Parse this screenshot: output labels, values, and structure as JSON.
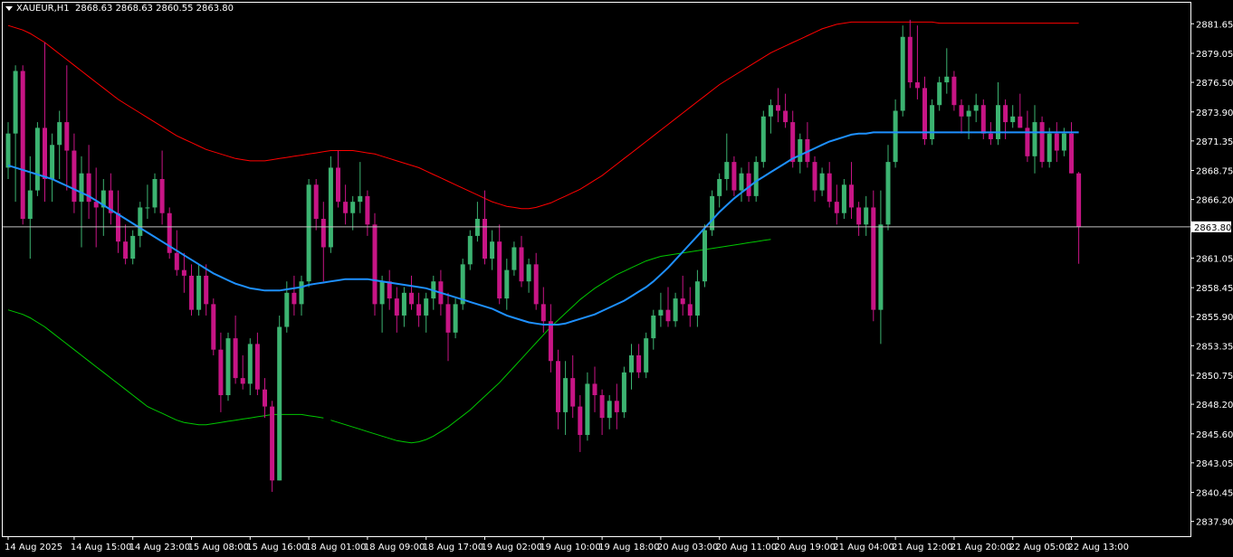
{
  "header": {
    "symbol": "XAUEUR,H1",
    "ohlc": "2868.63 2868.63 2860.55 2863.80"
  },
  "colors": {
    "background": "#000000",
    "frame": "#ffffff",
    "bull": "#3cb371",
    "bear": "#c71585",
    "ma": "#1e90ff",
    "upper_band": "#ff0000",
    "lower_band": "#00c800",
    "price_line": "#c0c0c0"
  },
  "chart_data": {
    "type": "candlestick",
    "symbol": "XAUEUR",
    "timeframe": "H1",
    "ylim": [
      2836.6,
      2883.5
    ],
    "y_ticks": [
      "2881.65",
      "2879.05",
      "2876.50",
      "2873.90",
      "2871.35",
      "2868.75",
      "2866.20",
      "2863.80",
      "2861.05",
      "2858.45",
      "2855.90",
      "2853.35",
      "2850.75",
      "2848.20",
      "2845.60",
      "2843.05",
      "2840.45",
      "2837.90"
    ],
    "x_labels": [
      "14 Aug 2025",
      "14 Aug 15:00",
      "14 Aug 23:00",
      "15 Aug 08:00",
      "15 Aug 16:00",
      "18 Aug 01:00",
      "18 Aug 09:00",
      "18 Aug 17:00",
      "19 Aug 02:00",
      "19 Aug 10:00",
      "19 Aug 18:00",
      "20 Aug 03:00",
      "20 Aug 11:00",
      "20 Aug 19:00",
      "21 Aug 04:00",
      "21 Aug 12:00",
      "21 Aug 20:00",
      "22 Aug 05:00",
      "22 Aug 13:00"
    ],
    "x_label_index": [
      0,
      9,
      17,
      25,
      33,
      41,
      49,
      57,
      65,
      73,
      81,
      89,
      97,
      105,
      113,
      121,
      129,
      137,
      145
    ],
    "current_price": 2863.8,
    "current_price_label": "2863.80",
    "candles": [
      [
        2869.0,
        2873.0,
        2868.0,
        2872.0
      ],
      [
        2872.0,
        2878.0,
        2866.0,
        2877.5
      ],
      [
        2877.5,
        2878.0,
        2864.0,
        2864.5
      ],
      [
        2864.5,
        2870.0,
        2861.0,
        2867.0
      ],
      [
        2867.0,
        2873.0,
        2866.5,
        2872.5
      ],
      [
        2872.5,
        2880.0,
        2866.0,
        2868.0
      ],
      [
        2868.0,
        2872.0,
        2866.0,
        2871.0
      ],
      [
        2871.0,
        2874.0,
        2868.0,
        2873.0
      ],
      [
        2873.0,
        2878.0,
        2867.0,
        2870.5
      ],
      [
        2870.5,
        2872.0,
        2865.0,
        2866.0
      ],
      [
        2866.0,
        2870.0,
        2862.0,
        2868.5
      ],
      [
        2868.5,
        2871.0,
        2864.5,
        2866.0
      ],
      [
        2866.0,
        2869.0,
        2862.0,
        2865.5
      ],
      [
        2865.5,
        2868.0,
        2863.0,
        2867.0
      ],
      [
        2867.0,
        2868.5,
        2864.0,
        2865.0
      ],
      [
        2865.0,
        2867.0,
        2861.5,
        2862.5
      ],
      [
        2862.5,
        2864.0,
        2860.5,
        2861.0
      ],
      [
        2861.0,
        2863.5,
        2860.5,
        2863.0
      ],
      [
        2863.0,
        2866.0,
        2862.0,
        2865.5
      ],
      [
        2865.5,
        2867.5,
        2864.5,
        2865.5
      ],
      [
        2865.5,
        2868.5,
        2865.0,
        2868.0
      ],
      [
        2868.0,
        2870.5,
        2864.0,
        2865.0
      ],
      [
        2865.0,
        2865.5,
        2861.0,
        2861.5
      ],
      [
        2861.5,
        2863.5,
        2859.5,
        2860.0
      ],
      [
        2860.0,
        2861.5,
        2858.0,
        2859.5
      ],
      [
        2859.5,
        2860.5,
        2856.0,
        2856.5
      ],
      [
        2856.5,
        2860.5,
        2856.0,
        2859.5
      ],
      [
        2859.5,
        2860.5,
        2856.0,
        2857.0
      ],
      [
        2857.0,
        2857.5,
        2852.5,
        2853.0
      ],
      [
        2853.0,
        2854.5,
        2847.5,
        2849.0
      ],
      [
        2849.0,
        2854.5,
        2848.5,
        2854.0
      ],
      [
        2854.0,
        2856.0,
        2850.0,
        2850.5
      ],
      [
        2850.5,
        2852.5,
        2849.5,
        2850.0
      ],
      [
        2850.0,
        2854.0,
        2849.0,
        2853.5
      ],
      [
        2853.5,
        2854.5,
        2849.0,
        2849.5
      ],
      [
        2849.5,
        2850.5,
        2847.0,
        2848.0
      ],
      [
        2848.0,
        2848.5,
        2840.5,
        2841.5
      ],
      [
        2841.5,
        2856.0,
        2841.5,
        2855.0
      ],
      [
        2855.0,
        2859.0,
        2854.5,
        2858.0
      ],
      [
        2858.0,
        2859.5,
        2856.0,
        2857.0
      ],
      [
        2857.0,
        2859.5,
        2856.0,
        2859.0
      ],
      [
        2859.0,
        2868.0,
        2858.5,
        2867.5
      ],
      [
        2867.5,
        2868.0,
        2863.5,
        2864.5
      ],
      [
        2864.5,
        2866.0,
        2859.0,
        2862.0
      ],
      [
        2862.0,
        2870.0,
        2861.5,
        2869.0
      ],
      [
        2869.0,
        2870.5,
        2865.5,
        2866.0
      ],
      [
        2866.0,
        2867.5,
        2864.0,
        2865.0
      ],
      [
        2865.0,
        2866.5,
        2863.5,
        2866.0
      ],
      [
        2866.0,
        2869.5,
        2865.0,
        2866.5
      ],
      [
        2866.5,
        2867.0,
        2863.0,
        2864.0
      ],
      [
        2864.0,
        2865.0,
        2856.0,
        2857.0
      ],
      [
        2857.0,
        2859.5,
        2854.5,
        2859.0
      ],
      [
        2859.0,
        2860.0,
        2856.5,
        2857.5
      ],
      [
        2857.5,
        2858.5,
        2854.5,
        2856.0
      ],
      [
        2856.0,
        2858.5,
        2855.0,
        2858.0
      ],
      [
        2858.0,
        2859.5,
        2856.5,
        2857.0
      ],
      [
        2857.0,
        2858.0,
        2855.0,
        2856.0
      ],
      [
        2856.0,
        2858.0,
        2854.5,
        2857.5
      ],
      [
        2857.5,
        2859.5,
        2856.5,
        2859.0
      ],
      [
        2859.0,
        2860.0,
        2856.0,
        2857.0
      ],
      [
        2857.0,
        2858.0,
        2852.0,
        2854.5
      ],
      [
        2854.5,
        2857.5,
        2854.0,
        2857.0
      ],
      [
        2857.0,
        2861.0,
        2856.5,
        2860.5
      ],
      [
        2860.5,
        2863.5,
        2860.0,
        2863.0
      ],
      [
        2863.0,
        2866.0,
        2862.5,
        2864.5
      ],
      [
        2864.5,
        2867.0,
        2860.5,
        2861.0
      ],
      [
        2861.0,
        2863.5,
        2860.0,
        2862.5
      ],
      [
        2862.5,
        2864.0,
        2857.0,
        2857.5
      ],
      [
        2857.5,
        2861.0,
        2856.5,
        2860.0
      ],
      [
        2860.0,
        2862.5,
        2859.5,
        2862.0
      ],
      [
        2862.0,
        2863.0,
        2858.5,
        2859.0
      ],
      [
        2859.0,
        2861.0,
        2858.0,
        2860.5
      ],
      [
        2860.5,
        2861.5,
        2856.5,
        2857.0
      ],
      [
        2857.0,
        2858.5,
        2854.5,
        2855.5
      ],
      [
        2855.5,
        2857.0,
        2851.0,
        2852.0
      ],
      [
        2852.0,
        2853.0,
        2846.0,
        2847.5
      ],
      [
        2847.5,
        2852.0,
        2845.5,
        2850.5
      ],
      [
        2850.5,
        2852.5,
        2847.0,
        2848.0
      ],
      [
        2848.0,
        2849.0,
        2844.0,
        2845.5
      ],
      [
        2845.5,
        2851.0,
        2845.0,
        2850.0
      ],
      [
        2850.0,
        2851.5,
        2847.5,
        2849.0
      ],
      [
        2849.0,
        2849.5,
        2845.5,
        2847.0
      ],
      [
        2847.0,
        2849.0,
        2846.0,
        2848.5
      ],
      [
        2848.5,
        2850.0,
        2846.0,
        2847.5
      ],
      [
        2847.5,
        2851.5,
        2847.0,
        2851.0
      ],
      [
        2851.0,
        2853.5,
        2849.5,
        2852.5
      ],
      [
        2852.5,
        2853.5,
        2850.5,
        2851.0
      ],
      [
        2851.0,
        2854.5,
        2850.5,
        2854.0
      ],
      [
        2854.0,
        2856.5,
        2853.0,
        2856.0
      ],
      [
        2856.0,
        2858.0,
        2855.0,
        2856.5
      ],
      [
        2856.5,
        2858.5,
        2855.0,
        2855.5
      ],
      [
        2855.5,
        2858.0,
        2855.0,
        2857.5
      ],
      [
        2857.5,
        2859.5,
        2856.0,
        2857.0
      ],
      [
        2857.0,
        2858.5,
        2855.0,
        2856.0
      ],
      [
        2856.0,
        2860.0,
        2855.0,
        2859.0
      ],
      [
        2859.0,
        2864.0,
        2858.5,
        2863.5
      ],
      [
        2863.5,
        2867.0,
        2863.0,
        2866.5
      ],
      [
        2866.5,
        2868.5,
        2865.5,
        2868.0
      ],
      [
        2868.0,
        2872.0,
        2867.0,
        2869.5
      ],
      [
        2869.5,
        2870.0,
        2866.5,
        2867.0
      ],
      [
        2867.0,
        2869.0,
        2866.0,
        2868.5
      ],
      [
        2868.5,
        2869.5,
        2866.0,
        2866.5
      ],
      [
        2866.5,
        2870.0,
        2866.0,
        2869.5
      ],
      [
        2869.5,
        2874.0,
        2869.0,
        2873.5
      ],
      [
        2873.5,
        2875.0,
        2872.0,
        2874.5
      ],
      [
        2874.5,
        2876.0,
        2873.0,
        2874.0
      ],
      [
        2874.0,
        2875.5,
        2872.5,
        2873.0
      ],
      [
        2873.0,
        2874.0,
        2869.0,
        2869.5
      ],
      [
        2869.5,
        2872.0,
        2868.5,
        2871.5
      ],
      [
        2871.5,
        2873.0,
        2869.0,
        2869.5
      ],
      [
        2869.5,
        2870.0,
        2866.0,
        2867.0
      ],
      [
        2867.0,
        2869.0,
        2866.5,
        2868.5
      ],
      [
        2868.5,
        2869.5,
        2865.5,
        2866.0
      ],
      [
        2866.0,
        2867.5,
        2864.0,
        2865.0
      ],
      [
        2865.0,
        2868.0,
        2864.5,
        2867.5
      ],
      [
        2867.5,
        2869.5,
        2864.5,
        2865.5
      ],
      [
        2865.5,
        2866.0,
        2863.0,
        2864.0
      ],
      [
        2864.0,
        2866.5,
        2863.0,
        2865.5
      ],
      [
        2865.5,
        2867.0,
        2855.5,
        2856.5
      ],
      [
        2856.5,
        2867.0,
        2853.5,
        2864.0
      ],
      [
        2864.0,
        2871.0,
        2863.5,
        2869.5
      ],
      [
        2869.5,
        2875.0,
        2869.0,
        2874.0
      ],
      [
        2874.0,
        2881.5,
        2873.5,
        2880.5
      ],
      [
        2880.5,
        2882.0,
        2876.0,
        2876.5
      ],
      [
        2876.5,
        2881.5,
        2875.0,
        2876.0
      ],
      [
        2876.0,
        2877.0,
        2871.0,
        2871.5
      ],
      [
        2871.5,
        2875.0,
        2871.0,
        2874.5
      ],
      [
        2874.5,
        2877.0,
        2874.0,
        2876.5
      ],
      [
        2876.5,
        2879.5,
        2875.5,
        2877.0
      ],
      [
        2877.0,
        2877.5,
        2874.0,
        2874.5
      ],
      [
        2874.5,
        2875.0,
        2872.0,
        2873.5
      ],
      [
        2873.5,
        2874.5,
        2871.5,
        2874.0
      ],
      [
        2874.0,
        2875.5,
        2873.0,
        2874.5
      ],
      [
        2874.5,
        2875.0,
        2871.5,
        2872.0
      ],
      [
        2872.0,
        2873.0,
        2871.0,
        2871.5
      ],
      [
        2871.5,
        2876.5,
        2871.0,
        2874.5
      ],
      [
        2874.5,
        2875.0,
        2871.5,
        2873.0
      ],
      [
        2873.0,
        2874.5,
        2872.5,
        2873.5
      ],
      [
        2873.5,
        2875.5,
        2872.5,
        2872.5
      ],
      [
        2872.5,
        2874.0,
        2869.5,
        2870.0
      ],
      [
        2870.0,
        2874.5,
        2868.5,
        2873.0
      ],
      [
        2873.0,
        2873.5,
        2869.0,
        2869.5
      ],
      [
        2869.5,
        2872.5,
        2869.0,
        2872.0
      ],
      [
        2872.0,
        2873.0,
        2869.5,
        2870.5
      ],
      [
        2870.5,
        2872.5,
        2870.0,
        2872.0
      ],
      [
        2872.0,
        2873.0,
        2868.5,
        2868.5
      ],
      [
        2868.5,
        2868.63,
        2860.55,
        2863.8
      ]
    ],
    "ma_series": [
      2869.2,
      2869.0,
      2868.8,
      2868.6,
      2868.4,
      2868.2,
      2868.0,
      2867.7,
      2867.4,
      2867.1,
      2866.8,
      2866.5,
      2866.1,
      2865.7,
      2865.3,
      2864.9,
      2864.5,
      2864.1,
      2863.7,
      2863.3,
      2862.9,
      2862.5,
      2862.1,
      2861.7,
      2861.3,
      2860.9,
      2860.5,
      2860.1,
      2859.7,
      2859.4,
      2859.1,
      2858.8,
      2858.6,
      2858.4,
      2858.3,
      2858.2,
      2858.2,
      2858.2,
      2858.3,
      2858.4,
      2858.5,
      2858.7,
      2858.8,
      2858.9,
      2859.0,
      2859.1,
      2859.2,
      2859.2,
      2859.2,
      2859.2,
      2859.1,
      2859.0,
      2858.9,
      2858.8,
      2858.7,
      2858.6,
      2858.5,
      2858.4,
      2858.2,
      2858.0,
      2857.8,
      2857.6,
      2857.4,
      2857.2,
      2857.0,
      2856.8,
      2856.6,
      2856.3,
      2856.0,
      2855.8,
      2855.6,
      2855.4,
      2855.3,
      2855.2,
      2855.2,
      2855.2,
      2855.3,
      2855.5,
      2855.7,
      2855.9,
      2856.1,
      2856.4,
      2856.7,
      2857.0,
      2857.3,
      2857.7,
      2858.1,
      2858.5,
      2859.0,
      2859.6,
      2860.2,
      2860.9,
      2861.6,
      2862.3,
      2863.0,
      2863.7,
      2864.4,
      2865.1,
      2865.7,
      2866.3,
      2866.8,
      2867.3,
      2867.8,
      2868.2,
      2868.6,
      2869.0,
      2869.4,
      2869.8,
      2870.1,
      2870.4,
      2870.7,
      2871.0,
      2871.3,
      2871.5,
      2871.7,
      2871.9,
      2872.0,
      2872.0,
      2872.1,
      2872.1,
      2872.1,
      2872.1,
      2872.1,
      2872.1,
      2872.1,
      2872.1,
      2872.1,
      2872.1,
      2872.1,
      2872.1,
      2872.1,
      2872.1,
      2872.1,
      2872.1,
      2872.1,
      2872.1,
      2872.1,
      2872.1,
      2872.1,
      2872.1,
      2872.1,
      2872.1,
      2872.1,
      2872.1,
      2872.1,
      2872.1,
      2872.1
    ],
    "upper_band": [
      2881.5,
      2881.3,
      2881.1,
      2880.8,
      2880.4,
      2880.0,
      2879.5,
      2879.0,
      2878.5,
      2878.0,
      2877.5,
      2877.0,
      2876.5,
      2876.0,
      2875.5,
      2875.0,
      2874.6,
      2874.2,
      2873.8,
      2873.4,
      2873.0,
      2872.6,
      2872.2,
      2871.8,
      2871.5,
      2871.2,
      2870.9,
      2870.6,
      2870.4,
      2870.2,
      2870.0,
      2869.8,
      2869.7,
      2869.6,
      2869.6,
      2869.6,
      2869.7,
      2869.8,
      2869.9,
      2870.0,
      2870.1,
      2870.2,
      2870.3,
      2870.4,
      2870.5,
      2870.5,
      2870.5,
      2870.5,
      2870.4,
      2870.3,
      2870.2,
      2870.0,
      2869.8,
      2869.6,
      2869.4,
      2869.2,
      2869.0,
      2868.7,
      2868.4,
      2868.1,
      2867.8,
      2867.5,
      2867.2,
      2866.9,
      2866.6,
      2866.3,
      2866.0,
      2865.8,
      2865.6,
      2865.5,
      2865.4,
      2865.4,
      2865.5,
      2865.7,
      2865.9,
      2866.2,
      2866.5,
      2866.8,
      2867.1,
      2867.5,
      2867.9,
      2868.3,
      2868.8,
      2869.3,
      2869.8,
      2870.3,
      2870.8,
      2871.3,
      2871.8,
      2872.3,
      2872.8,
      2873.3,
      2873.8,
      2874.3,
      2874.8,
      2875.3,
      2875.8,
      2876.3,
      2876.7,
      2877.1,
      2877.5,
      2877.9,
      2878.3,
      2878.7,
      2879.1,
      2879.4,
      2879.7,
      2880.0,
      2880.3,
      2880.6,
      2880.9,
      2881.2,
      2881.4,
      2881.6,
      2881.7,
      2881.8,
      2881.8,
      2881.8,
      2881.8,
      2881.8,
      2881.8,
      2881.8,
      2881.8,
      2881.8,
      2881.8,
      2881.8,
      2881.8,
      2881.7,
      2881.7,
      2881.7,
      2881.7,
      2881.7,
      2881.7,
      2881.7,
      2881.7,
      2881.7,
      2881.7,
      2881.7,
      2881.7,
      2881.7,
      2881.7,
      2881.7,
      2881.7,
      2881.7,
      2881.7,
      2881.7,
      2881.7
    ],
    "lower_band": [
      2856.5,
      2856.3,
      2856.1,
      2855.8,
      2855.4,
      2855.0,
      2854.5,
      2854.0,
      2853.5,
      2853.0,
      2852.5,
      2852.0,
      2851.5,
      2851.0,
      2850.5,
      2850.0,
      2849.5,
      2849.0,
      2848.5,
      2848.0,
      2847.7,
      2847.4,
      2847.1,
      2846.8,
      2846.6,
      2846.5,
      2846.4,
      2846.4,
      2846.5,
      2846.6,
      2846.7,
      2846.8,
      2846.9,
      2847.0,
      2847.1,
      2847.2,
      2847.3,
      2847.3,
      2847.3,
      2847.3,
      2847.3,
      2847.2,
      2847.1,
      2847.0,
      2846.8,
      2846.6,
      2846.4,
      2846.2,
      2846.0,
      2845.8,
      2845.6,
      2845.4,
      2845.2,
      2845.0,
      2844.9,
      2844.8,
      2844.9,
      2845.1,
      2845.4,
      2845.8,
      2846.2,
      2846.7,
      2847.2,
      2847.7,
      2848.3,
      2848.9,
      2849.5,
      2850.1,
      2850.8,
      2851.5,
      2852.2,
      2852.9,
      2853.6,
      2854.3,
      2855.0,
      2855.6,
      2856.2,
      2856.8,
      2857.4,
      2857.9,
      2858.4,
      2858.8,
      2859.2,
      2859.6,
      2859.9,
      2860.2,
      2860.5,
      2860.8,
      2861.0,
      2861.2,
      2861.3,
      2861.4,
      2861.5,
      2861.6,
      2861.7,
      2861.8,
      2861.9,
      2862.0,
      2862.1,
      2862.2,
      2862.3,
      2862.4,
      2862.5,
      2862.6,
      2862.7
    ],
    "lower_band_start": 44
  }
}
